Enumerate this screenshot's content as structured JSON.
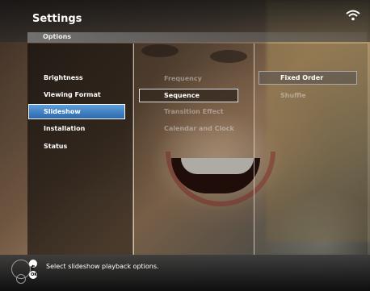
{
  "header": {
    "title": "Settings",
    "subtitle": "Options"
  },
  "menu": {
    "column1": [
      "Brightness",
      "Viewing Format",
      "Slideshow",
      "Installation",
      "Status"
    ],
    "selected1": "Slideshow",
    "column2": [
      "Frequency",
      "Sequence",
      "Transition Effect",
      "Calendar and Clock"
    ],
    "selected2": "Sequence",
    "column3": [
      "Fixed Order",
      "Shuffle"
    ],
    "selected3": "Fixed Order"
  },
  "footer": {
    "status_text": "Select slideshow playback options.",
    "ok_label": "OK"
  },
  "colors": {
    "selection_blue": "#3f84c8"
  },
  "icons": [
    "wifi-icon",
    "back-icon",
    "ok-icon",
    "navigation-ring-icon"
  ]
}
